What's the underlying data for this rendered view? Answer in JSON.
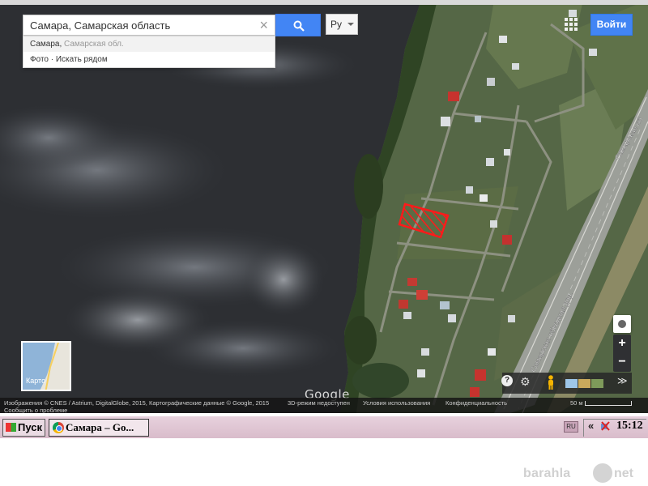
{
  "search": {
    "value": "Самара, Самарская область",
    "clear_icon": "close-icon",
    "button_icon": "search-icon"
  },
  "suggestions": [
    {
      "primary": "Самара,",
      "secondary": " Самарская обл."
    },
    {
      "primary": "Фото · Искать рядом",
      "secondary": ""
    }
  ],
  "language": {
    "selected": "Ру"
  },
  "header": {
    "apps_icon": "apps-grid-icon",
    "signin_label": "Войти"
  },
  "map_switcher": {
    "label": "Карто"
  },
  "map_labels": {
    "road_1": "Самарская обводная дор.",
    "road_2": "Самарская об"
  },
  "controls": {
    "zoom_in": "+",
    "zoom_out": "−",
    "help": "?",
    "expand": "≫"
  },
  "google_logo": "Google",
  "footer": {
    "imagery": "Изображения © CNES / Astrium, DigitalGlobe, 2015, Картографические данные © Google, 2015",
    "report": "Сообщить о проблеме",
    "unavailable": "3D-режим недоступен",
    "terms": "Условия использования",
    "privacy": "Конфиденциальность",
    "scale": "50 м"
  },
  "taskbar": {
    "start_label": "Пуск",
    "window_label": "Самара – Go...",
    "lang_indicator": "RU",
    "tray_chevron": "«",
    "clock": "15:12"
  },
  "watermark": {
    "left": "barahla",
    "right": "net"
  },
  "colors": {
    "water": "#2c2e31",
    "land": "#4a5b3a",
    "accent": "#4285f4",
    "plot_outline": "#ff1a1a",
    "taskbar": "#e2c8d6"
  }
}
